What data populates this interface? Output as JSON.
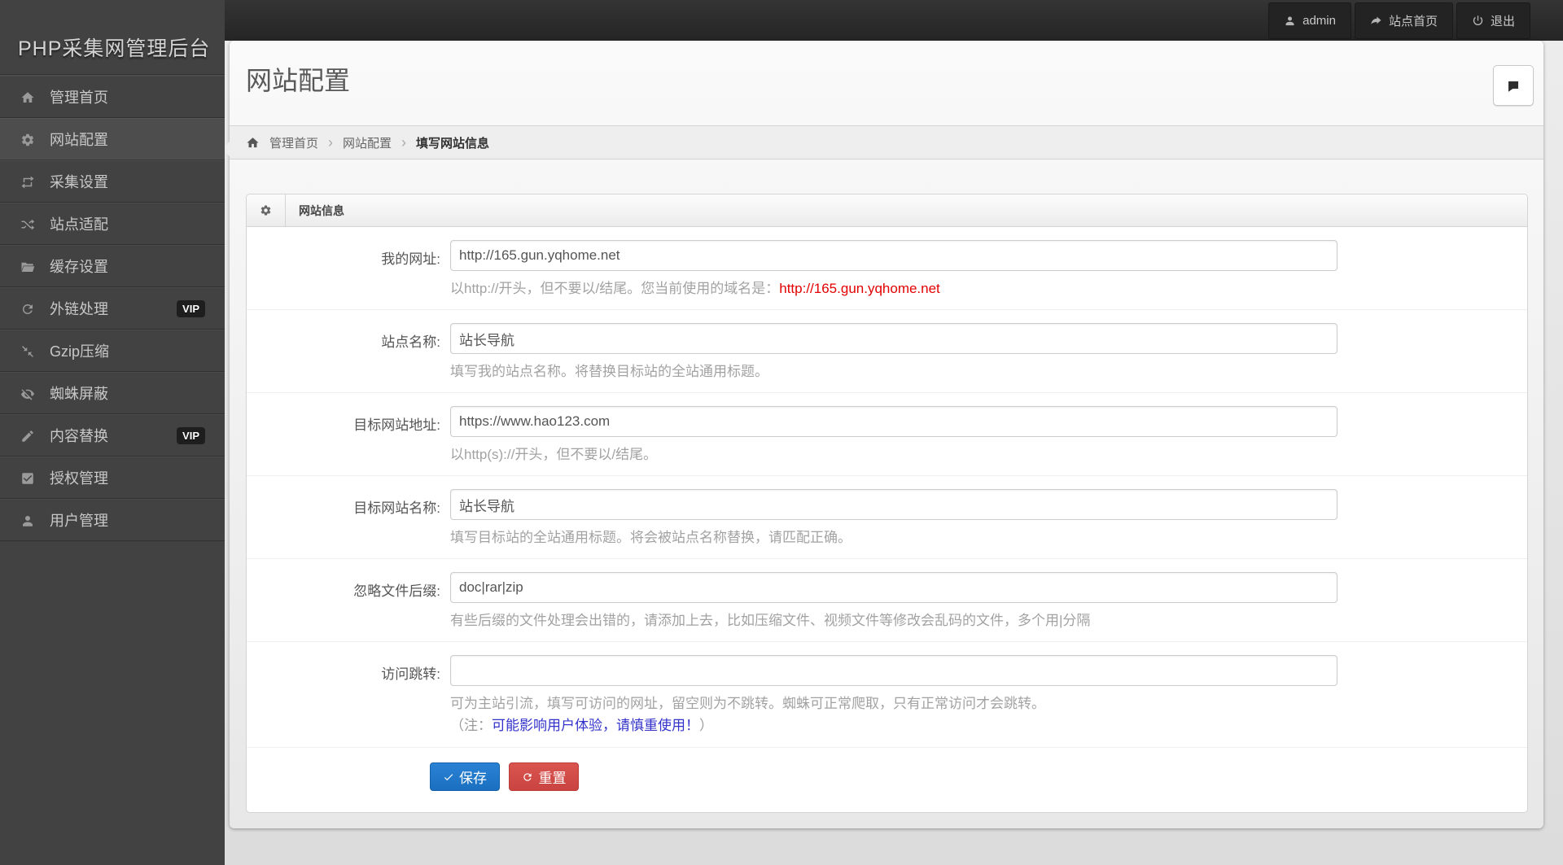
{
  "app": {
    "logo_title": "PHP采集网管理后台"
  },
  "topbar": {
    "user_label": "admin",
    "site_home_label": "站点首页",
    "logout_label": "退出"
  },
  "sidebar": {
    "vip_badge": "VIP",
    "items": [
      {
        "label": "管理首页",
        "icon": "home-icon",
        "active": false
      },
      {
        "label": "网站配置",
        "icon": "gear-icon",
        "active": true
      },
      {
        "label": "采集设置",
        "icon": "collect-icon",
        "active": false
      },
      {
        "label": "站点适配",
        "icon": "shuffle-icon",
        "active": false
      },
      {
        "label": "缓存设置",
        "icon": "folder-icon",
        "active": false
      },
      {
        "label": "外链处理",
        "icon": "refresh-icon",
        "active": false,
        "vip": true
      },
      {
        "label": "Gzip压缩",
        "icon": "compress-icon",
        "active": false
      },
      {
        "label": "蜘蛛屏蔽",
        "icon": "eye-slash-icon",
        "active": false
      },
      {
        "label": "内容替换",
        "icon": "pencil-icon",
        "active": false,
        "vip": true
      },
      {
        "label": "授权管理",
        "icon": "check-square-icon",
        "active": false
      },
      {
        "label": "用户管理",
        "icon": "user-icon",
        "active": false
      }
    ]
  },
  "page": {
    "title": "网站配置"
  },
  "breadcrumb": {
    "home": "管理首页",
    "section": "网站配置",
    "current": "填写网站信息"
  },
  "panel": {
    "title": "网站信息"
  },
  "form": {
    "fields": [
      {
        "label": "我的网址:",
        "value": "http://165.gun.yqhome.net",
        "help": "以http://开头，但不要以/结尾。您当前使用的域名是：",
        "help_link": "http://165.gun.yqhome.net"
      },
      {
        "label": "站点名称:",
        "value": "站长导航",
        "help": "填写我的站点名称。将替换目标站的全站通用标题。"
      },
      {
        "label": "目标网站地址:",
        "value": "https://www.hao123.com",
        "help": "以http(s)://开头，但不要以/结尾。"
      },
      {
        "label": "目标网站名称:",
        "value": "站长导航",
        "help": "填写目标站的全站通用标题。将会被站点名称替换，请匹配正确。"
      },
      {
        "label": "忽略文件后缀:",
        "value": "doc|rar|zip",
        "help": "有些后缀的文件处理会出错的，请添加上去，比如压缩文件、视频文件等修改会乱码的文件，多个用|分隔"
      },
      {
        "label": "访问跳转:",
        "value": "",
        "help": "可为主站引流，填写可访问的网址，留空则为不跳转。蜘蛛可正常爬取，只有正常访问才会跳转。",
        "note_prefix": "（注：",
        "note_link": "可能影响用户体验，请慎重使用！",
        "note_suffix": "）"
      }
    ],
    "save_label": "保存",
    "reset_label": "重置"
  },
  "colors": {
    "topbar_bg": "#2a2a2a",
    "sidebar_bg": "#424242",
    "accent_blue": "#1d72c8",
    "danger_red": "#d9534f",
    "link_red": "#e20000",
    "link_blue": "#3333cc"
  }
}
